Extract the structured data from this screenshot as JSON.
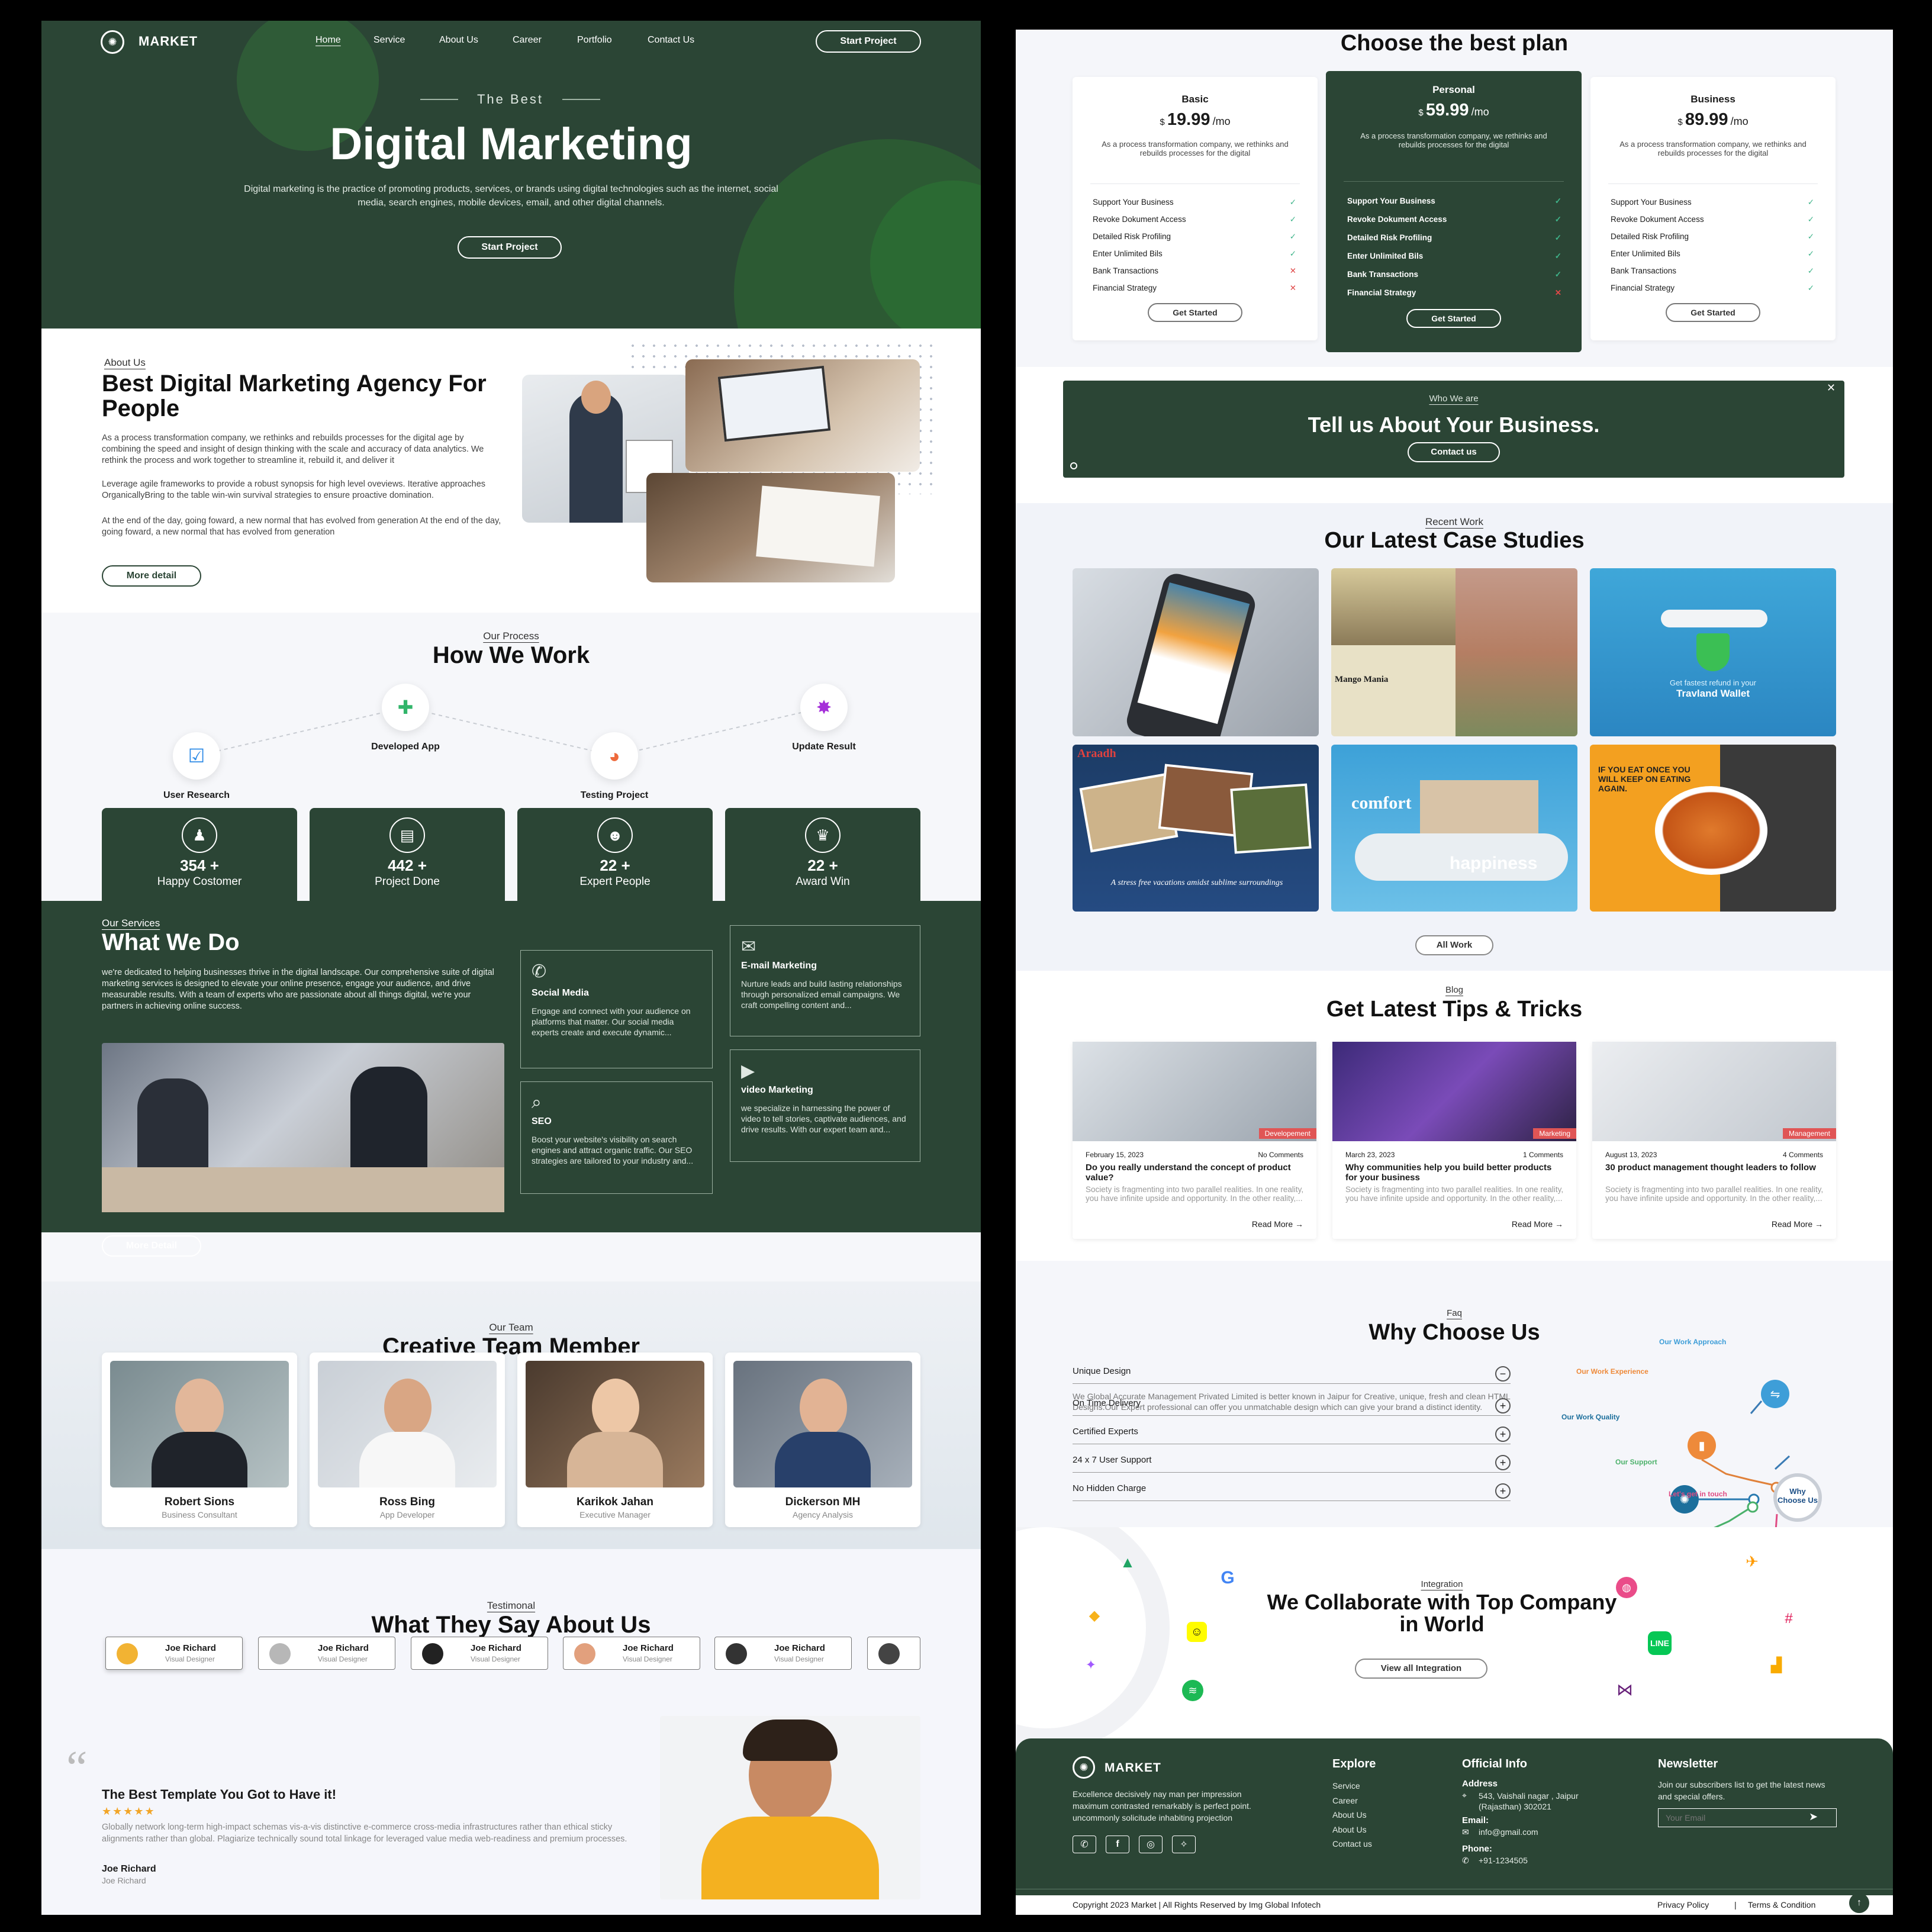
{
  "nav": {
    "logo": "MARKET",
    "links": [
      "Home",
      "Service",
      "About Us",
      "Career",
      "Portfolio",
      "Contact Us"
    ],
    "cta": "Start Project"
  },
  "hero": {
    "eyebrow": "The Best",
    "title": "Digital Marketing",
    "text": "Digital marketing is the practice of promoting products, services, or brands using digital technologies such as the internet, social media, search engines, mobile devices, email, and other digital channels.",
    "button": "Start Project"
  },
  "about": {
    "eyebrow": "About Us",
    "title": "Best Digital Marketing Agency For People",
    "p1": "As a process transformation company, we rethinks and rebuilds processes for the digital age by combining the speed and insight of design thinking with the scale and accuracy of data analytics. We rethink the process and work together to streamline it, rebuild it, and deliver it",
    "p2": "Leverage agile frameworks to provide a robust synopsis for high level oveviews. Iterative approaches OrganicallyBring to the table win-win survival strategies to ensure proactive domination.",
    "p3": "At the end of the day, going foward, a new normal that has evolved from generation At the end of the day, going foward, a new normal that has evolved from generation",
    "button": "More detail"
  },
  "process": {
    "eyebrow": "Our Process",
    "title": "How We Work",
    "steps": [
      "User Research",
      "Developed App",
      "Testing Project",
      "Update Result"
    ]
  },
  "stats": [
    {
      "value": "354 +",
      "label": "Happy Costomer"
    },
    {
      "value": "442 +",
      "label": "Project Done"
    },
    {
      "value": "22 +",
      "label": "Expert People"
    },
    {
      "value": "22 +",
      "label": "Award Win"
    }
  ],
  "services": {
    "eyebrow": "Our Services",
    "title": "What We Do",
    "text": "we're dedicated to helping businesses thrive in the digital landscape. Our comprehensive suite of digital marketing services is designed to elevate your online presence, engage your audience, and drive measurable results. With a team of experts who are passionate about all things digital, we're your partners in achieving online success.",
    "button": "More Detail",
    "items": [
      {
        "title": "Social Media",
        "text": "Engage and connect with your audience on platforms that matter. Our social media experts create and execute dynamic..."
      },
      {
        "title": "E-mail Marketing",
        "text": "Nurture leads and build lasting relationships through personalized email campaigns. We craft compelling content and..."
      },
      {
        "title": "SEO",
        "text": "Boost your website's visibility on search engines and attract organic traffic. Our SEO strategies are tailored to your industry and..."
      },
      {
        "title": "video Marketing",
        "text": "we specialize in harnessing the power of video to tell stories, captivate audiences, and drive results. With our expert team and..."
      }
    ]
  },
  "team": {
    "eyebrow": "Our Team",
    "title": "Creative Team Member",
    "members": [
      {
        "name": "Robert Sions",
        "role": "Business Consultant"
      },
      {
        "name": "Ross Bing",
        "role": "App Developer"
      },
      {
        "name": "Karikok Jahan",
        "role": "Executive Manager"
      },
      {
        "name": "Dickerson MH",
        "role": "Agency Analysis"
      }
    ]
  },
  "testimonial": {
    "eyebrow": "Testimonal",
    "title": "What They Say About Us",
    "people": [
      {
        "name": "Joe Richard",
        "role": "Visual Designer"
      },
      {
        "name": "Joe Richard",
        "role": "Visual Designer"
      },
      {
        "name": "Joe Richard",
        "role": "Visual Designer"
      },
      {
        "name": "Joe Richard",
        "role": "Visual Designer"
      },
      {
        "name": "Joe Richard",
        "role": "Visual Designer"
      }
    ],
    "quote_title": "The Best Template You Got to Have it!",
    "stars": "★★★★★",
    "quote": "Globally network long-term high-impact schemas vis-a-vis distinctive e-commerce cross-media infrastructures rather than ethical sticky alignments rather than global. Plagiarize technically sound total linkage for leveraged value media web-readiness and premium processes.",
    "author": "Joe Richard",
    "author_sub": "Joe Richard"
  },
  "pricing": {
    "title": "Choose the best plan",
    "plans": [
      {
        "name": "Basic",
        "currency": "$",
        "price": "19.99",
        "per": "/mo",
        "desc": "As a process transformation company, we rethinks and rebuilds processes for the digital",
        "features": [
          [
            "Support Your Business",
            "✓"
          ],
          [
            "Revoke Dokument Access",
            "✓"
          ],
          [
            "Detailed Risk Profiling",
            "✓"
          ],
          [
            "Enter Unlimited Bils",
            "✓"
          ],
          [
            "Bank Transactions",
            "✕"
          ],
          [
            "Financial Strategy",
            "✕"
          ]
        ],
        "button": "Get Started"
      },
      {
        "name": "Personal",
        "currency": "$",
        "price": "59.99",
        "per": "/mo",
        "desc": "As a process transformation company, we rethinks and rebuilds processes for the digital",
        "features": [
          [
            "Support Your Business",
            "✓"
          ],
          [
            "Revoke Dokument Access",
            "✓"
          ],
          [
            "Detailed Risk Profiling",
            "✓"
          ],
          [
            "Enter Unlimited Bils",
            "✓"
          ],
          [
            "Bank Transactions",
            "✓"
          ],
          [
            "Financial Strategy",
            "✕"
          ]
        ],
        "button": "Get Started"
      },
      {
        "name": "Business",
        "currency": "$",
        "price": "89.99",
        "per": "/mo",
        "desc": "As a process transformation company, we rethinks and rebuilds processes for the digital",
        "features": [
          [
            "Support Your Business",
            "✓"
          ],
          [
            "Revoke Dokument Access",
            "✓"
          ],
          [
            "Detailed Risk Profiling",
            "✓"
          ],
          [
            "Enter Unlimited Bils",
            "✓"
          ],
          [
            "Bank Transactions",
            "✓"
          ],
          [
            "Financial Strategy",
            "✓"
          ]
        ],
        "button": "Get Started"
      }
    ]
  },
  "cta": {
    "eyebrow": "Who We are",
    "title": "Tell us About Your Business.",
    "button": "Contact us",
    "close": "✕"
  },
  "work": {
    "eyebrow": "Recent Work",
    "title": "Our Latest Case Studies",
    "button": "All Work",
    "tiles": [
      {
        "a": "",
        "b": ""
      },
      {
        "a": "Mango Mania",
        "b": ""
      },
      {
        "a": "Get fastest refund in your",
        "b": "Travland Wallet"
      },
      {
        "a": "Araadh",
        "b": "A stress free vacations amidst sublime surroundings"
      },
      {
        "a": "comfort",
        "b": "happiness"
      },
      {
        "a": "IF YOU EAT ONCE YOU WILL KEEP ON EATING AGAIN.",
        "b": ""
      }
    ]
  },
  "blog": {
    "eyebrow": "Blog",
    "title": "Get Latest Tips & Tricks",
    "read": "Read More →",
    "posts": [
      {
        "tag": "Developement",
        "date": "February 15, 2023",
        "comments": "No Comments",
        "title": "Do you really understand the concept of product value?",
        "text": "Society is fragmenting into two parallel realities. In one reality, you have infinite upside and opportunity. In the other reality,..."
      },
      {
        "tag": "Marketing",
        "date": "March 23, 2023",
        "comments": "1 Comments",
        "title": "Why communities help you build better products for your business",
        "text": "Society is fragmenting into two parallel realities. In one reality, you have infinite upside and opportunity. In the other reality,..."
      },
      {
        "tag": "Management",
        "date": "August 13, 2023",
        "comments": "4 Comments",
        "title": "30 product management thought leaders to follow",
        "text": "Society is fragmenting into two parallel realities. In one reality, you have infinite upside and opportunity. In the other reality,..."
      }
    ]
  },
  "faq": {
    "eyebrow": "Faq",
    "title": "Why Choose Us",
    "open_q": "Unique Design",
    "open_a": "We Global Accurate Management Privated Limited is better known in Jaipur for Creative, unique, fresh and clean HTML Designs.Our Expert professional can offer you unmatchable design which can give your brand a distinct identity.",
    "items": [
      "On Time Delivery",
      "Certified Experts",
      "24 x 7 User Support",
      "No Hidden Charge"
    ],
    "diagram": {
      "center": "Why Choose Us",
      "labels": [
        "Our Work Approach",
        "Our Work Experience",
        "Our Work Quality",
        "Our Support",
        "Let's get in touch"
      ]
    }
  },
  "integration": {
    "eyebrow": "Integration",
    "title": "We Collaborate with Top Company in World",
    "button": "View all Integration"
  },
  "footer": {
    "logo": "MARKET",
    "about": "Excellence decisively nay man per impression maximum contrasted remarkably is perfect point. uncommonly solicitude inhabiting projection",
    "explore_title": "Explore",
    "explore": [
      "Service",
      "Career",
      "About Us",
      "About Us",
      "Contact us"
    ],
    "info_title": "Official Info",
    "address_label": "Address",
    "address": "543, Vaishali nagar , Jaipur (Rajasthan) 302021",
    "email_label": "Email:",
    "email": "info@gmail.com",
    "phone_label": "Phone:",
    "phone": "+91-1234505",
    "news_title": "Newsletter",
    "news_text": "Join our subscribers list to get the latest news and special offers.",
    "news_placeholder": "Your Email",
    "copyright": "Copyright 2023 Market | All Rights Reserved by Img Global Infotech",
    "privacy": "Privacy Policy",
    "sep": "|",
    "terms": "Terms & Condition",
    "top": "↑"
  },
  "colors": {
    "primary": "#2b4535",
    "check": "#3fb48a",
    "cross": "#e04848",
    "tag": "#e05555"
  }
}
